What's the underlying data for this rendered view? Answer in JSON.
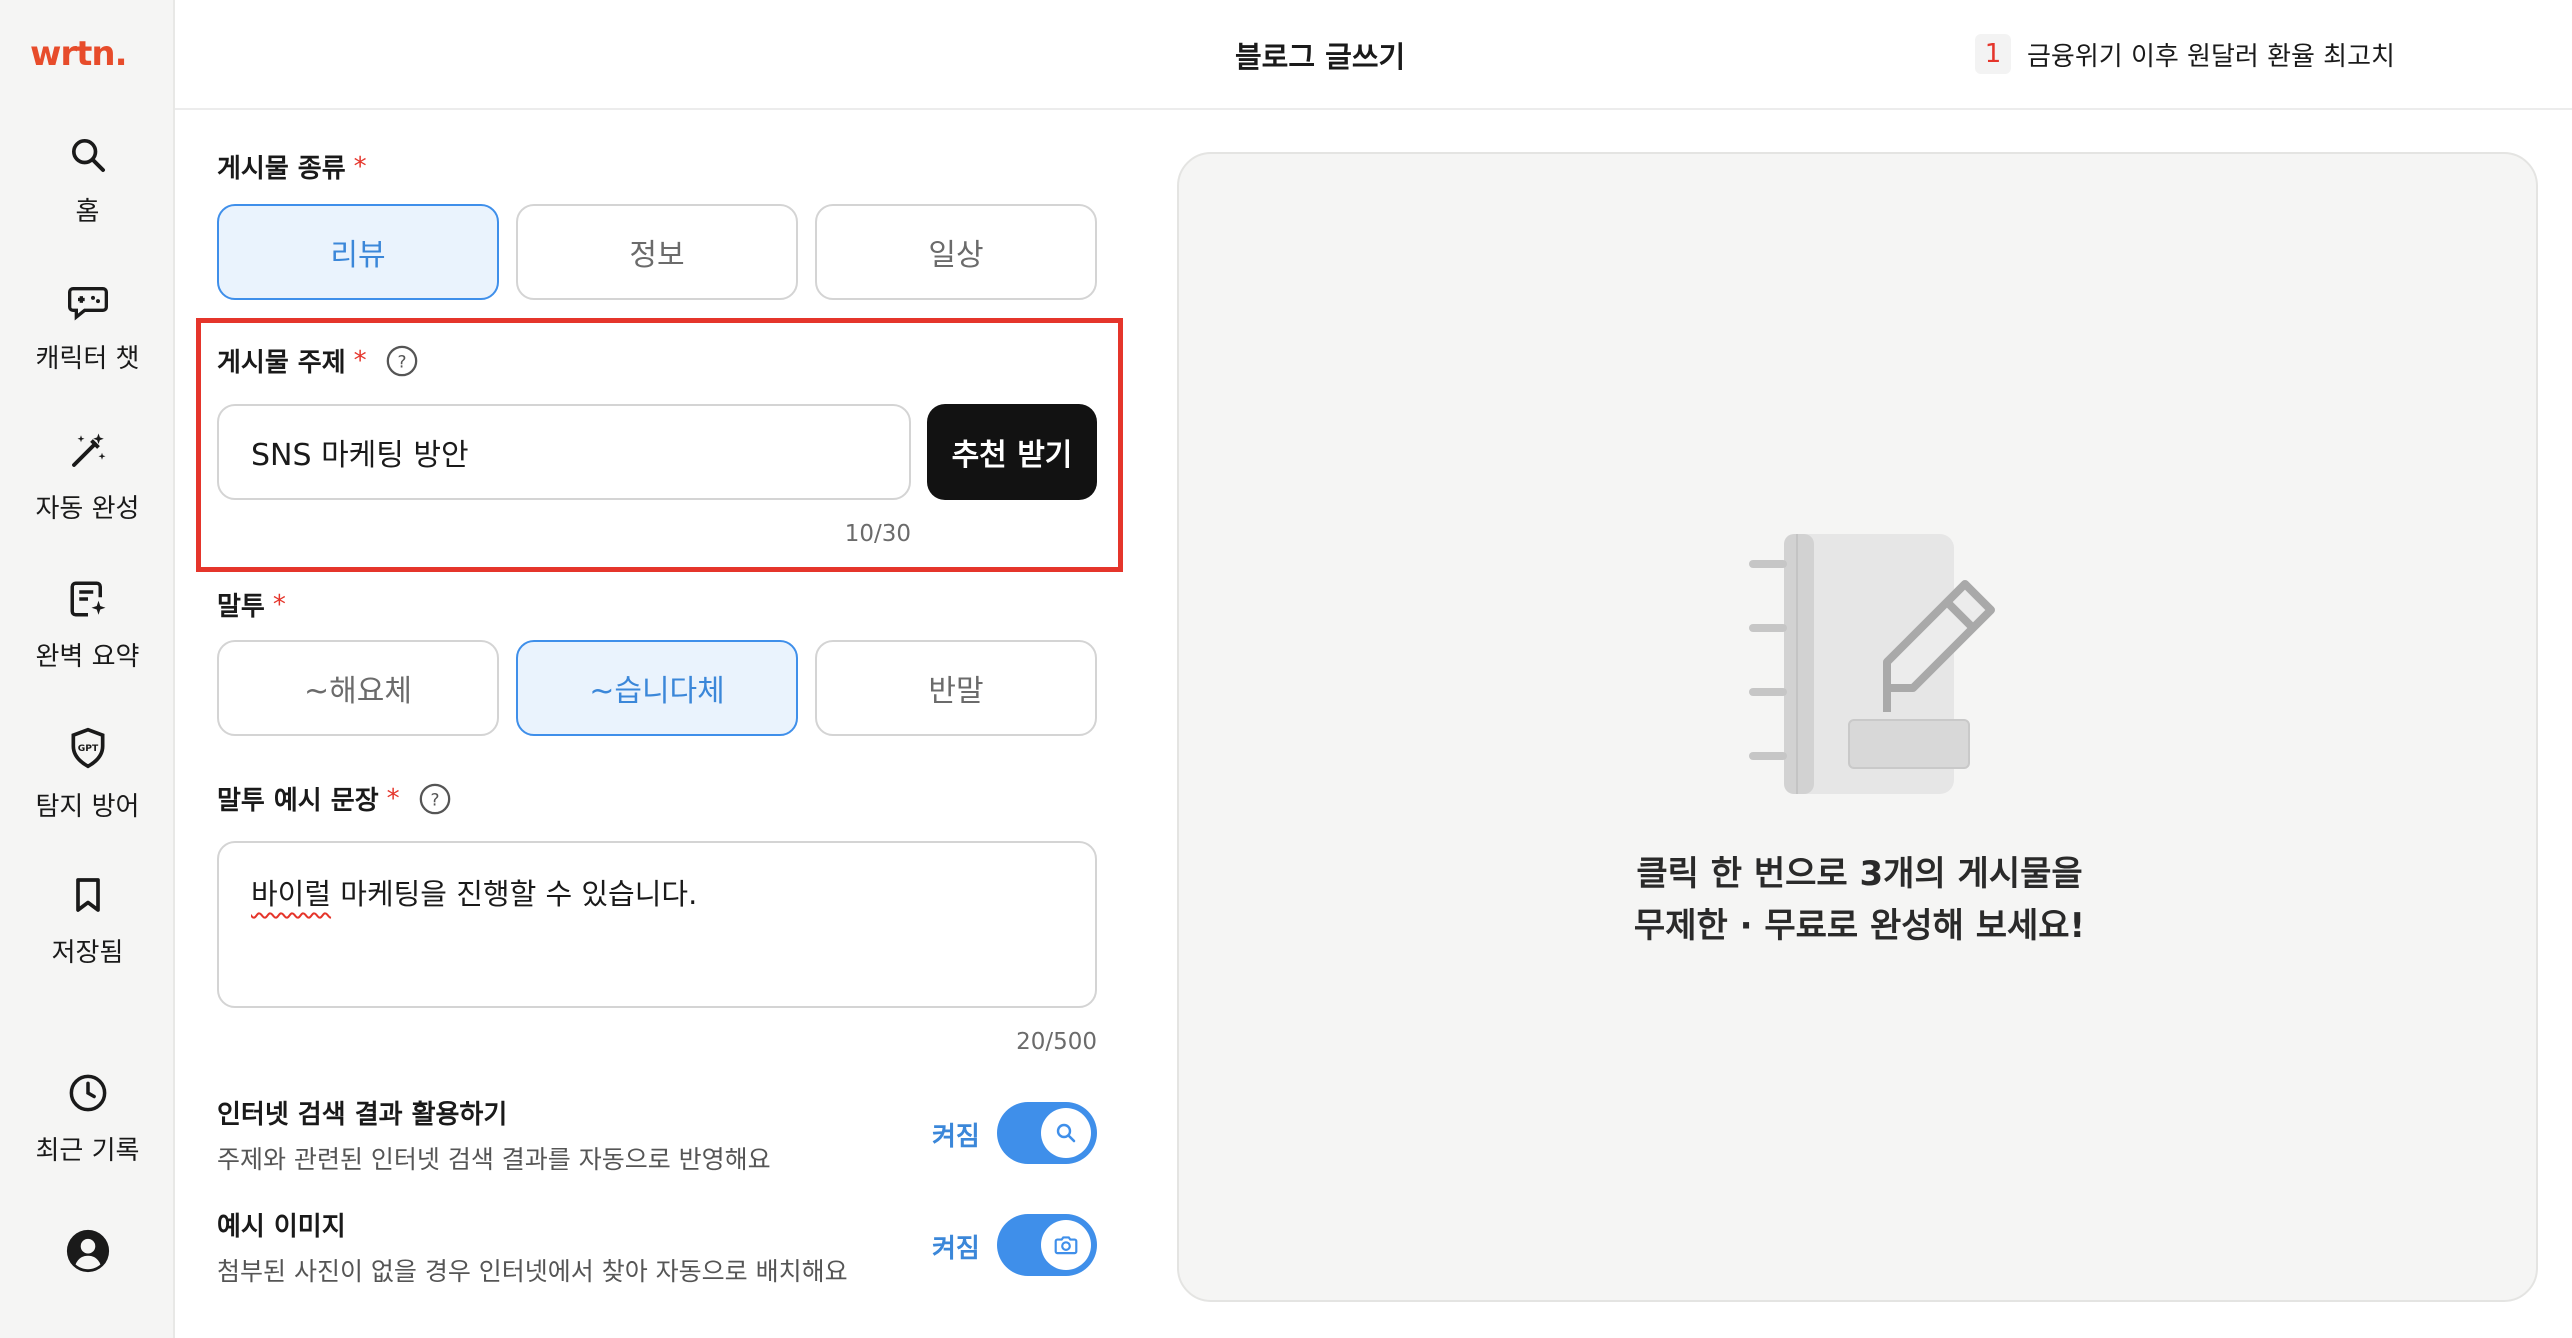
{
  "app": {
    "logo": "wrtn."
  },
  "sidebar": {
    "items": [
      {
        "label": "홈",
        "icon": "search-icon"
      },
      {
        "label": "캐릭터 챗",
        "icon": "game-chat-icon"
      },
      {
        "label": "자동 완성",
        "icon": "magic-wand-icon"
      },
      {
        "label": "완벽 요약",
        "icon": "summary-doc-icon"
      },
      {
        "label": "탐지 방어",
        "icon": "gpt-shield-icon"
      },
      {
        "label": "저장됨",
        "icon": "bookmark-icon"
      },
      {
        "label": "최근 기록",
        "icon": "clock-icon"
      }
    ],
    "profile_icon": "user-avatar-icon"
  },
  "header": {
    "title": "블로그 글쓰기",
    "trend": {
      "rank": "1",
      "text": "금융위기 이후 원달러 환율 최고치"
    }
  },
  "form": {
    "post_type": {
      "label": "게시물 종류",
      "required_mark": "*",
      "options": [
        "리뷰",
        "정보",
        "일상"
      ],
      "selected": "리뷰"
    },
    "topic": {
      "label": "게시물 주제",
      "required_mark": "*",
      "value": "SNS 마케팅 방안",
      "recommend_button": "추천 받기",
      "counter": "10/30"
    },
    "tone": {
      "label": "말투",
      "required_mark": "*",
      "options": [
        "~해요체",
        "~습니다체",
        "반말"
      ],
      "selected": "~습니다체"
    },
    "tone_example": {
      "label": "말투 예시 문장",
      "required_mark": "*",
      "value_underlined": "바이럴",
      "value_rest": " 마케팅을 진행할 수 있습니다.",
      "counter": "20/500"
    },
    "web_search": {
      "title": "인터넷 검색 결과 활용하기",
      "desc": "주제와 관련된 인터넷 검색 결과를 자동으로 반영해요",
      "state_label": "켜짐",
      "enabled": true
    },
    "example_image": {
      "title": "예시 이미지",
      "desc": "첨부된 사진이 없을 경우 인터넷에서 찾아 자동으로 배치해요",
      "state_label": "켜짐",
      "enabled": true
    }
  },
  "preview": {
    "line1": "클릭 한 번으로 3개의 게시물을",
    "line2": "무제한 · 무료로 완성해 보세요!"
  },
  "colors": {
    "brand": "#e74c2b",
    "accent_blue": "#3f8fea",
    "selected_bg": "#eaf3fd",
    "highlight": "#e5352b"
  }
}
